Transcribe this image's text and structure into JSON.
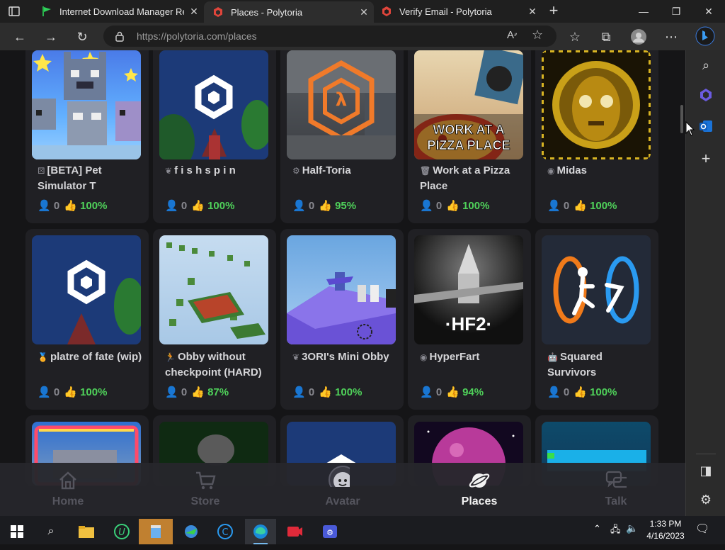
{
  "browser": {
    "tabs": [
      {
        "title": "Internet Download Manager Reg",
        "favicon": "green-flag-icon",
        "active": false
      },
      {
        "title": "Places - Polytoria",
        "favicon": "polytoria-icon",
        "active": true
      },
      {
        "title": "Verify Email - Polytoria",
        "favicon": "polytoria-icon",
        "active": false
      }
    ],
    "url": "https://polytoria.com/places"
  },
  "places": [
    {
      "name": "[BETA] Pet Simulator T",
      "genre_icon": "puzzle-icon",
      "players": "0",
      "rating": "100%"
    },
    {
      "name": "f i s h s p i n",
      "genre_icon": "leaf-icon",
      "players": "0",
      "rating": "100%"
    },
    {
      "name": "Half-Toria",
      "genre_icon": "gear-icon",
      "players": "0",
      "rating": "95%"
    },
    {
      "name": "Work at a Pizza Place",
      "genre_icon": "trash-icon",
      "players": "0",
      "rating": "100%"
    },
    {
      "name": "Midas",
      "genre_icon": "compass-icon",
      "players": "0",
      "rating": "100%"
    },
    {
      "name": "platre of fate (wip)",
      "genre_icon": "medal-icon",
      "players": "0",
      "rating": "100%"
    },
    {
      "name": "Obby without checkpoint (HARD)",
      "genre_icon": "running-icon",
      "players": "0",
      "rating": "87%"
    },
    {
      "name": "3ORI's Mini Obby",
      "genre_icon": "leaf-icon",
      "players": "0",
      "rating": "100%"
    },
    {
      "name": "HyperFart",
      "genre_icon": "compass-icon",
      "players": "0",
      "rating": "94%"
    },
    {
      "name": "Squared Survivors",
      "genre_icon": "robot-icon",
      "players": "0",
      "rating": "100%"
    }
  ],
  "thumb_text": {
    "pizza": "WORK AT A PIZZA PLACE",
    "hf2": "·HF2·"
  },
  "nav": {
    "home": "Home",
    "store": "Store",
    "avatar": "Avatar",
    "places": "Places",
    "talk": "Talk"
  },
  "taskbar": {
    "time": "1:33 PM",
    "date": "4/16/2023"
  },
  "colors": {
    "accent_green": "#4fd15a",
    "card_bg": "#202024",
    "page_bg": "#151517"
  }
}
